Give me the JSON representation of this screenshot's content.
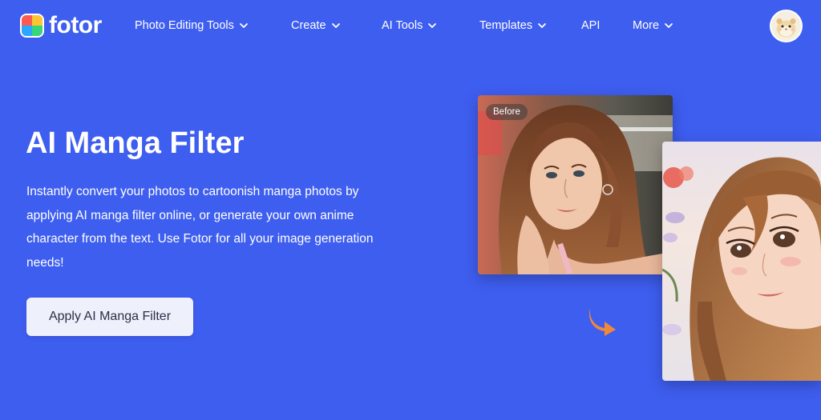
{
  "brand": {
    "name": "fotor",
    "logo_colors": [
      "#ff5a4f",
      "#ffc531",
      "#2aa7ff",
      "#37d67a"
    ]
  },
  "nav": {
    "items": [
      {
        "label": "Photo Editing Tools",
        "has_dropdown": true
      },
      {
        "label": "Create",
        "has_dropdown": true
      },
      {
        "label": "AI Tools",
        "has_dropdown": true
      },
      {
        "label": "Templates",
        "has_dropdown": true
      },
      {
        "label": "API",
        "has_dropdown": false
      },
      {
        "label": "More",
        "has_dropdown": true
      }
    ]
  },
  "hero": {
    "title": "AI Manga Filter",
    "description": "Instantly convert your photos to cartoonish manga photos by applying AI manga filter online, or generate your own anime character from the text. Use Fotor for all your image generation needs!",
    "cta_label": "Apply AI Manga Filter",
    "before_label": "Before"
  },
  "colors": {
    "background": "#3e5ef0",
    "cta_background": "#eef0fc",
    "arrow": "#f0883a"
  }
}
